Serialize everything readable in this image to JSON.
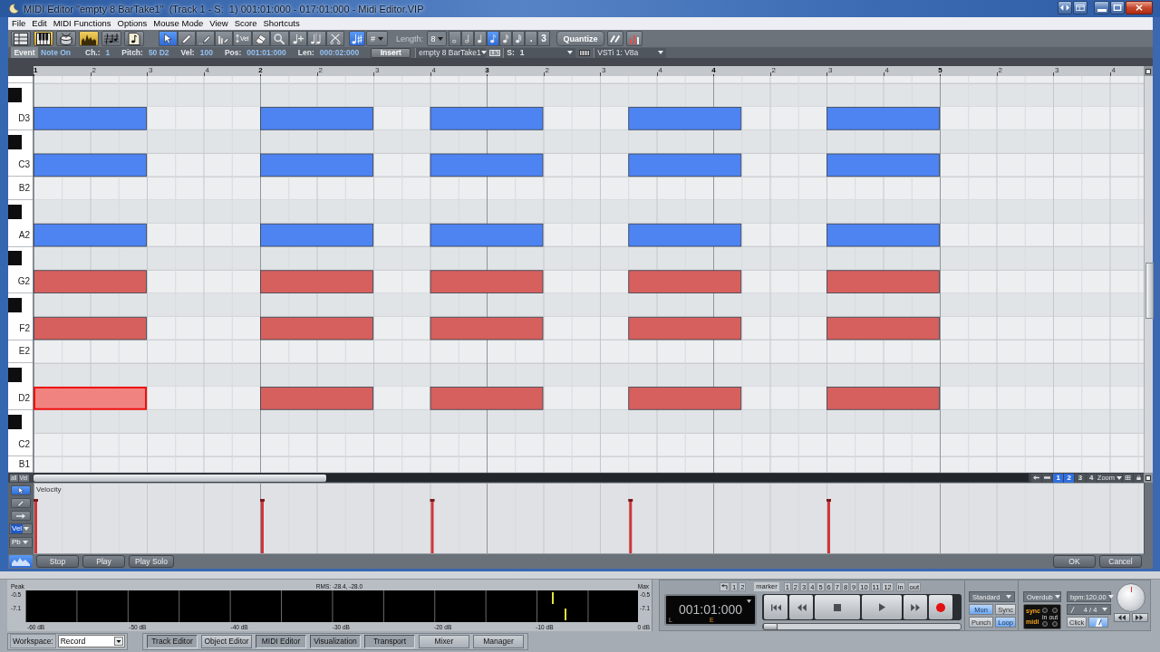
{
  "window": {
    "title": "MIDI Editor \"empty 8 BarTake1\"  (Track 1 - S:  1) 001:01:000 - 017:01:000 - Midi Editor.VIP"
  },
  "menu": [
    "File",
    "Edit",
    "MIDI Functions",
    "Options",
    "Mouse Mode",
    "View",
    "Score",
    "Shortcuts"
  ],
  "toolbar": {
    "view_buttons": [
      {
        "selected": false
      },
      {
        "selected": true
      },
      {
        "selected": false
      },
      {
        "selected": true
      },
      {
        "selected": false
      },
      {
        "selected": false
      }
    ],
    "tool_buttons": [
      {
        "selected": true
      },
      {
        "selected": false
      },
      {
        "selected": false
      },
      {
        "selected": false
      },
      {
        "label": "Vel",
        "selected": false
      },
      {
        "selected": false
      },
      {
        "selected": false
      },
      {
        "selected": false
      },
      {
        "selected": false
      },
      {
        "selected": false
      }
    ],
    "accidental_button": {
      "selected": true
    },
    "accidental_menu": "#",
    "length_label": "Length:",
    "length_value": "8",
    "length_buttons": [
      {
        "selected": false
      },
      {
        "selected": false
      },
      {
        "selected": false
      },
      {
        "selected": true
      },
      {
        "selected": false
      },
      {
        "selected": false
      },
      {
        "label": ".",
        "selected": false
      },
      {
        "label": "3",
        "selected": false
      }
    ],
    "quantize": "Quantize"
  },
  "event_bar": {
    "label": "Event",
    "type": "Note On",
    "fields": [
      {
        "label": "Ch.:",
        "value": "1"
      },
      {
        "label": "Pitch:",
        "value": "50 D2"
      },
      {
        "label": "Vel:",
        "value": "100"
      },
      {
        "label": "Pos:",
        "value": "001:01:000"
      },
      {
        "label": "Len:",
        "value": "000:02:000"
      }
    ],
    "insert": "Insert",
    "object": "empty 8 BarTake1",
    "s_label": "S:",
    "s_value": "1",
    "instrument": "VSTi 1: V8a"
  },
  "piano_roll": {
    "keys": [
      {
        "kind": "white"
      },
      {
        "kind": "black"
      },
      {
        "kind": "white"
      },
      {
        "kind": "black"
      },
      {
        "kind": "white"
      },
      {
        "kind": "white"
      },
      {
        "kind": "black"
      },
      {
        "kind": "white"
      },
      {
        "kind": "black"
      },
      {
        "kind": "white"
      },
      {
        "kind": "black"
      },
      {
        "kind": "white"
      },
      {
        "kind": "white"
      },
      {
        "kind": "black"
      },
      {
        "kind": "white"
      },
      {
        "kind": "black"
      },
      {
        "kind": "white"
      },
      {
        "kind": "white"
      }
    ],
    "ruler_beats": [
      [
        "2",
        "3",
        "4"
      ],
      [
        "2",
        "3",
        "4"
      ],
      [
        "2",
        "3",
        "4"
      ],
      [
        "2",
        "3",
        "4"
      ],
      [
        "2",
        "3",
        "4"
      ]
    ],
    "chart_data": [
      {
        "type": "bar",
        "orientation": "horizontal",
        "grid": true,
        "categories": [
          null,
          null,
          "D3",
          null,
          "C3",
          "B2",
          null,
          "A2",
          null,
          "G2",
          null,
          "F2",
          "E2",
          null,
          "D2",
          null,
          "C2",
          "B1"
        ],
        "xlim": [
          1,
          5.9
        ],
        "xticks": [
          1,
          2,
          3,
          4,
          5
        ],
        "series": [
          {
            "base": [
              null,
              null,
              1,
              null,
              1,
              null,
              null,
              1,
              null,
              1,
              null,
              1,
              null,
              null,
              1,
              null,
              null,
              null
            ],
            "values": [
              null,
              null,
              0.5,
              null,
              0.5,
              null,
              null,
              0.5,
              null,
              0.5,
              null,
              0.5,
              null,
              null,
              0.5,
              null,
              null,
              null
            ],
            "colors": [
              null,
              null,
              "#4d84f2",
              null,
              "#4d84f2",
              null,
              null,
              "#4d84f2",
              null,
              "#d6605d",
              null,
              "#d6605d",
              null,
              null,
              "#f0837f",
              null,
              null,
              null
            ]
          },
          {
            "base": [
              null,
              null,
              2,
              null,
              2,
              null,
              null,
              2,
              null,
              2,
              null,
              2,
              null,
              null,
              2,
              null,
              null,
              null
            ],
            "values": [
              null,
              null,
              0.5,
              null,
              0.5,
              null,
              null,
              0.5,
              null,
              0.5,
              null,
              0.5,
              null,
              null,
              0.5,
              null,
              null,
              null
            ],
            "colors": [
              null,
              null,
              "#4d84f2",
              null,
              "#4d84f2",
              null,
              null,
              "#4d84f2",
              null,
              "#d6605d",
              null,
              "#d6605d",
              null,
              null,
              "#d6605d",
              null,
              null,
              null
            ]
          },
          {
            "base": [
              null,
              null,
              2.75,
              null,
              2.75,
              null,
              null,
              2.75,
              null,
              2.75,
              null,
              2.75,
              null,
              null,
              2.75,
              null,
              null,
              null
            ],
            "values": [
              null,
              null,
              0.5,
              null,
              0.5,
              null,
              null,
              0.5,
              null,
              0.5,
              null,
              0.5,
              null,
              null,
              0.5,
              null,
              null,
              null
            ],
            "colors": [
              null,
              null,
              "#4d84f2",
              null,
              "#4d84f2",
              null,
              null,
              "#4d84f2",
              null,
              "#d6605d",
              null,
              "#d6605d",
              null,
              null,
              "#d6605d",
              null,
              null,
              null
            ]
          },
          {
            "base": [
              null,
              null,
              3.625,
              null,
              3.625,
              null,
              null,
              3.625,
              null,
              3.625,
              null,
              3.625,
              null,
              null,
              3.625,
              null,
              null,
              null
            ],
            "values": [
              null,
              null,
              0.5,
              null,
              0.5,
              null,
              null,
              0.5,
              null,
              0.5,
              null,
              0.5,
              null,
              null,
              0.5,
              null,
              null,
              null
            ],
            "colors": [
              null,
              null,
              "#4d84f2",
              null,
              "#4d84f2",
              null,
              null,
              "#4d84f2",
              null,
              "#d6605d",
              null,
              "#d6605d",
              null,
              null,
              "#d6605d",
              null,
              null,
              null
            ]
          },
          {
            "base": [
              null,
              null,
              4.5,
              null,
              4.5,
              null,
              null,
              4.5,
              null,
              4.5,
              null,
              4.5,
              null,
              null,
              4.5,
              null,
              null,
              null
            ],
            "values": [
              null,
              null,
              0.5,
              null,
              0.5,
              null,
              null,
              0.5,
              null,
              0.5,
              null,
              0.5,
              null,
              null,
              0.5,
              null,
              null,
              null
            ],
            "colors": [
              null,
              null,
              "#4d84f2",
              null,
              "#4d84f2",
              null,
              null,
              "#4d84f2",
              null,
              "#d6605d",
              null,
              "#d6605d",
              null,
              null,
              "#d6605d",
              null,
              null,
              null
            ]
          }
        ]
      }
    ]
  },
  "scroll_buttons": [
    "all",
    "Vel"
  ],
  "zoom": {
    "presets": [
      {
        "label": "1",
        "selected": true
      },
      {
        "label": "2",
        "selected": true
      },
      {
        "label": "3",
        "selected": false
      },
      {
        "label": "4",
        "selected": false
      }
    ],
    "menu": "Zoom"
  },
  "velocity": {
    "label": "Velocity",
    "tools": [
      {
        "selected": true
      },
      {
        "selected": false
      },
      {
        "selected": false
      }
    ],
    "controllers": [
      {
        "label": "Vel",
        "selected": true
      },
      {
        "label": "Pb",
        "selected": false
      }
    ]
  },
  "editor_buttons": {
    "curve_toggle": {
      "selected": true
    },
    "left": [
      "Stop",
      "Play",
      "Play Solo"
    ],
    "right": [
      "OK",
      "Cancel"
    ]
  },
  "meter": {
    "peak": "Peak",
    "rms": "RMS: -28.4, -28.0",
    "max": "Max",
    "left_scale": [
      "-0.5",
      "-7.1"
    ],
    "right_scale": [
      "-0.5",
      "-7.1"
    ],
    "scale": [
      "-60 dB",
      "-50 dB",
      "-40 dB",
      "-30 dB",
      "-20 dB",
      "-10 dB",
      "0 dB"
    ],
    "channels": [
      {
        "level": 0.86
      },
      {
        "level": 0.88
      }
    ]
  },
  "transport": {
    "history": [
      "1",
      "2"
    ],
    "marker": "marker",
    "markers": [
      "1",
      "2",
      "3",
      "4",
      "5",
      "6",
      "7",
      "8",
      "9",
      "10",
      "11",
      "12"
    ],
    "range": [
      "in",
      "out"
    ],
    "time": "001:01:000",
    "time_left": "L",
    "time_end": "E",
    "position": {
      "level": 0
    },
    "mode": "Standard",
    "toggles": [
      {
        "label": "Mon",
        "on": true
      },
      {
        "label": "Sync",
        "on": false
      },
      {
        "label": "Punch",
        "on": false
      },
      {
        "label": "Loop",
        "on": true
      }
    ],
    "record_mode": "Overdub",
    "sync_labels": [
      "sync",
      "midi"
    ],
    "io_labels": [
      "in",
      "out"
    ],
    "tempo": "bpm:120,00",
    "signature": "4 / 4",
    "click": "Click",
    "metronome": {
      "on": true
    }
  },
  "workspace": {
    "label": "Workspace:",
    "value": "Record"
  },
  "window_tabs": [
    {
      "label": "Track Editor",
      "on": true
    },
    {
      "label": "Object Editor",
      "on": false
    },
    {
      "label": "MIDI Editor",
      "on": true
    },
    {
      "label": "Visualization",
      "on": true
    },
    {
      "label": "Transport",
      "on": true
    },
    {
      "label": "Mixer",
      "on": false
    },
    {
      "label": "Manager",
      "on": false
    }
  ]
}
